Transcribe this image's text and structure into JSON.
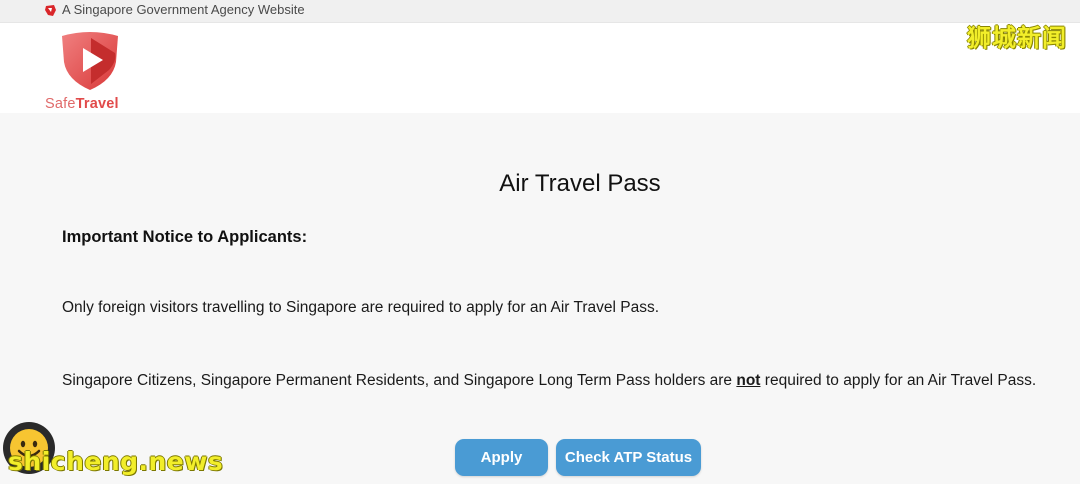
{
  "gov_banner": {
    "text": "A Singapore Government Agency Website",
    "icon": "lion-head-icon"
  },
  "logo": {
    "word_safe": "Safe",
    "word_travel": "Travel",
    "icon": "play-shield-icon",
    "brand_color": "#e14a4a"
  },
  "watermarks": {
    "top_right": "狮城新闻",
    "bottom_left": "shicheng.news",
    "color": "#f2ee2a"
  },
  "main": {
    "title": "Air Travel Pass",
    "notice_heading": "Important Notice to Applicants:",
    "paragraph_1": "Only foreign visitors travelling to Singapore are required to apply for an Air Travel Pass.",
    "paragraph_2_before": "Singapore Citizens, Singapore Permanent Residents, and Singapore Long Term Pass holders are ",
    "paragraph_2_emphasis": "not",
    "paragraph_2_after": " required to apply for an Air Travel Pass."
  },
  "actions": {
    "apply_label": "Apply",
    "check_status_label": "Check ATP Status",
    "button_color": "#4a9bd4"
  }
}
